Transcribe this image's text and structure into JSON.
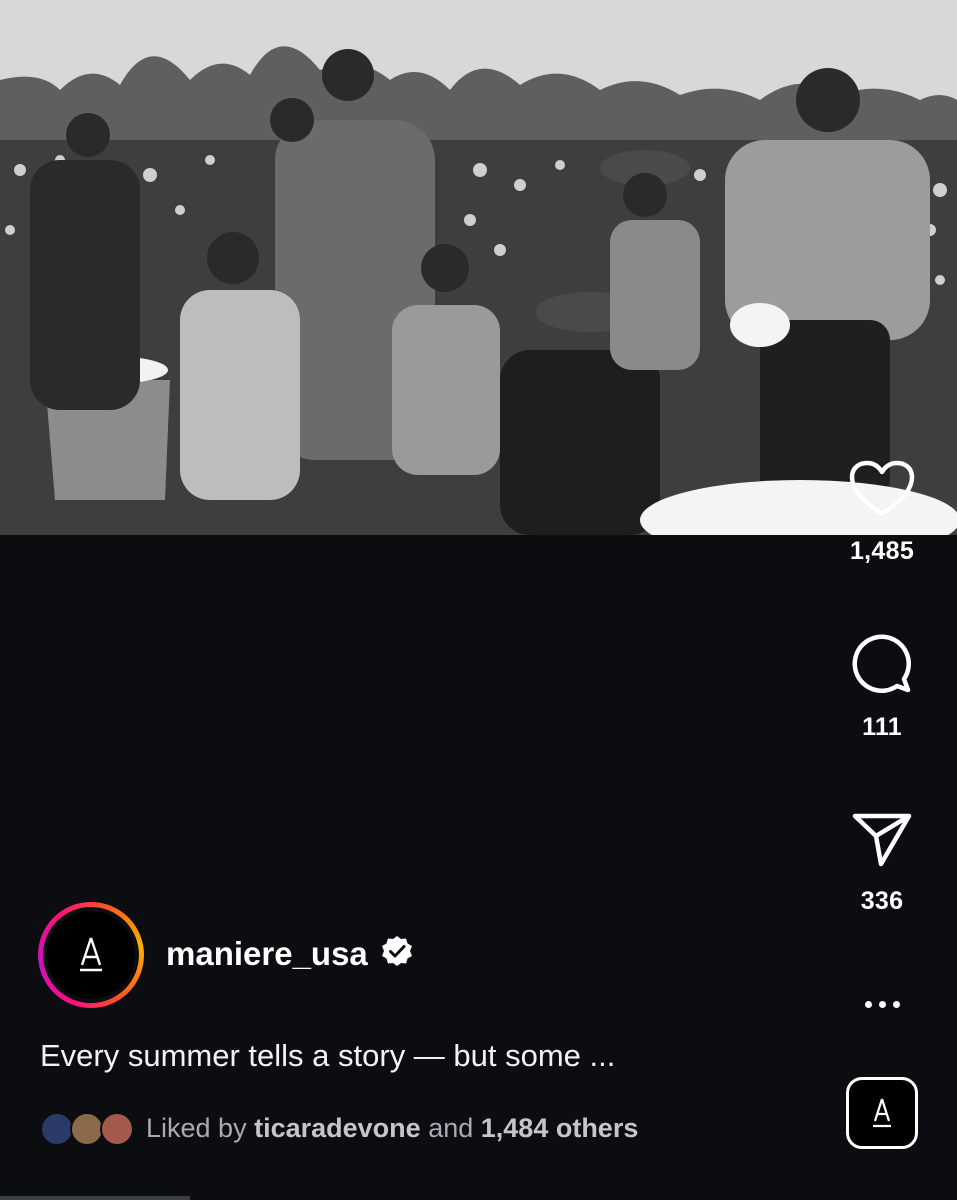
{
  "post": {
    "image_alt": "Black and white photograph of a family standing in a cotton field",
    "likes_count": "1,485",
    "comments_count": "111",
    "shares_count": "336"
  },
  "account": {
    "username": "maniere_usa",
    "verified": true,
    "avatar_letter": "A"
  },
  "caption": "Every summer tells a story — but some ...",
  "liked_by": {
    "prefix": "Liked by",
    "user": "ticaradevone",
    "middle": "and",
    "others": "1,484 others"
  },
  "icons": {
    "like": "heart-icon",
    "comment": "comment-bubble-icon",
    "share": "paper-plane-icon",
    "more": "more-dots-icon",
    "verified": "verified-badge-icon",
    "audio": "audio-thumbnail-icon"
  },
  "colors": {
    "background": "#0b0d11",
    "text": "#ffffff",
    "muted_text": "#a8abb3",
    "ring_start": "#ff0f7b",
    "ring_end": "#ffb000"
  }
}
